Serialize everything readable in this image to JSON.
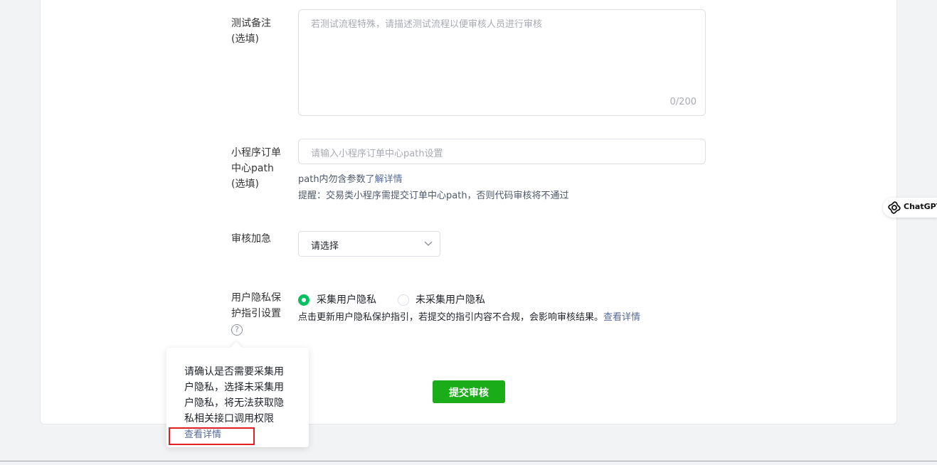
{
  "form": {
    "test_notes": {
      "label_line1": "测试备注",
      "label_line2": "(选填)",
      "placeholder": "若测试流程特殊，请描述测试流程以便审核人员进行审核",
      "counter": "0/200"
    },
    "order_path": {
      "label_line1": "小程序订单",
      "label_line2": "中心path",
      "label_line3": "(选填)",
      "placeholder": "请输入小程序订单中心path设置",
      "hint_text": "path内勿含参数",
      "hint_link": "了解详情",
      "reminder": "提醒：交易类小程序需提交订单中心path，否则代码审核将不通过"
    },
    "expedite": {
      "label": "审核加急",
      "selected": "请选择"
    },
    "privacy": {
      "label_line1": "用户隐私保",
      "label_line2": "护指引设置",
      "options": [
        "采集用户隐私",
        "未采集用户隐私"
      ],
      "selected_index": 0,
      "note": "点击更新用户隐私保护指引，若提交的指引内容不合规，会影响审核结果。",
      "note_link": "查看详情"
    },
    "submit_label": "提交审核"
  },
  "tooltip": {
    "lines": [
      "请确认是否需要采集用",
      "户隐私，选择未采集用",
      "户隐私，将无法获取隐",
      "私相关接口调用权限"
    ],
    "link": "查看详情"
  },
  "extension": {
    "label": "ChatGPT"
  },
  "colors": {
    "primary_green": "#1aad19",
    "radio_green": "#07c160",
    "link_blue": "#576b95",
    "highlight_red": "#e02020"
  },
  "icons": {
    "help": "question-circle-icon",
    "dropdown": "chevron-down-icon",
    "extension": "openai-logo-icon"
  }
}
